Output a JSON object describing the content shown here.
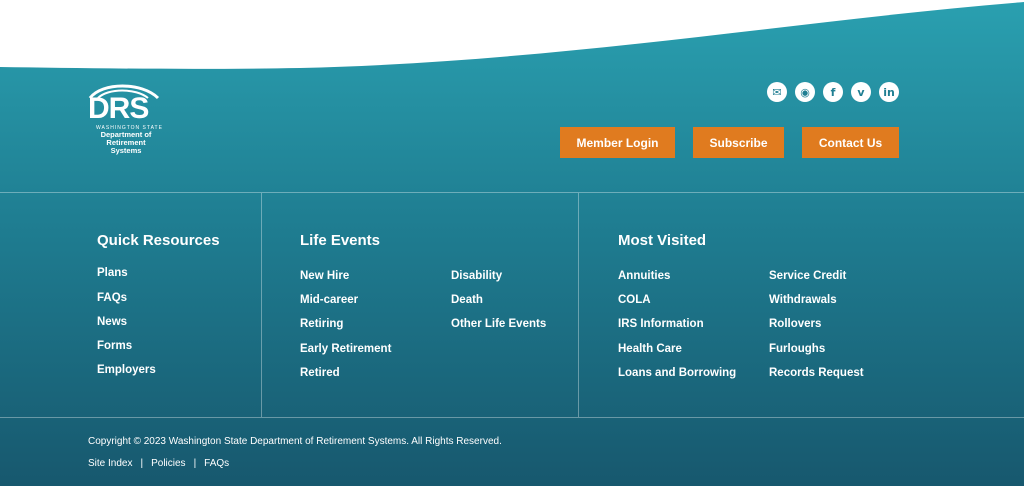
{
  "logo": {
    "main": "DRS",
    "state": "WASHINGTON STATE",
    "dept_line1": "Department of",
    "dept_line2": "Retirement Systems"
  },
  "social": {
    "icons": [
      "email-icon",
      "podcast-icon",
      "facebook-icon",
      "vimeo-icon",
      "linkedin-icon"
    ],
    "glyphs": [
      "✉",
      "◉",
      "f",
      "v",
      "in"
    ]
  },
  "buttons": {
    "member_login": "Member Login",
    "subscribe": "Subscribe",
    "contact_us": "Contact Us"
  },
  "quick_resources": {
    "title": "Quick Resources",
    "items": [
      "Plans",
      "FAQs",
      "News",
      "Forms",
      "Employers"
    ]
  },
  "life_events": {
    "title": "Life Events",
    "col1": [
      "New Hire",
      "Mid-career",
      "Retiring",
      "Early Retirement",
      "Retired"
    ],
    "col2": [
      "Disability",
      "Death",
      "Other Life Events"
    ]
  },
  "most_visited": {
    "title": "Most Visited",
    "col1": [
      "Annuities",
      "COLA",
      "IRS Information",
      "Health Care",
      "Loans and Borrowing"
    ],
    "col2": [
      "Service Credit",
      "Withdrawals",
      "Rollovers",
      "Furloughs",
      "Records Request"
    ]
  },
  "footer": {
    "copyright": "Copyright © 2023 Washington State Department of Retirement Systems. All Rights Reserved.",
    "links": [
      "Site Index",
      "Policies",
      "FAQs"
    ],
    "separator": "|"
  },
  "colors": {
    "accent": "#e07b1f",
    "teal_top": "#2aa0b0",
    "teal_bottom": "#17586e"
  }
}
